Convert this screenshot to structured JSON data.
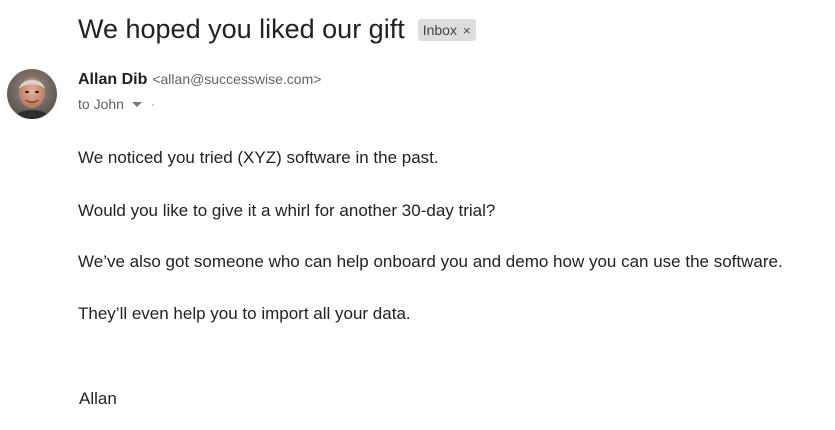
{
  "subject": "We hoped you liked our gift",
  "label": {
    "text": "Inbox",
    "close_glyph": "×"
  },
  "sender": {
    "name": "Allan Dib",
    "email": "<allan@successwise.com>",
    "avatar_icon": "avatar-photo"
  },
  "recipient": {
    "text": "to John",
    "details_icon": "chevron-down-icon",
    "extra_icon": "dot-icon"
  },
  "message": {
    "p1": "We noticed you tried (XYZ) software in the past.",
    "p2": "Would you like to give it a whirl for another 30-day trial?",
    "p3": "We’ve also got someone who can help onboard you and demo how you can use the software.",
    "p4": "They’ll even help you to import all your data.",
    "signature": "Allan"
  }
}
